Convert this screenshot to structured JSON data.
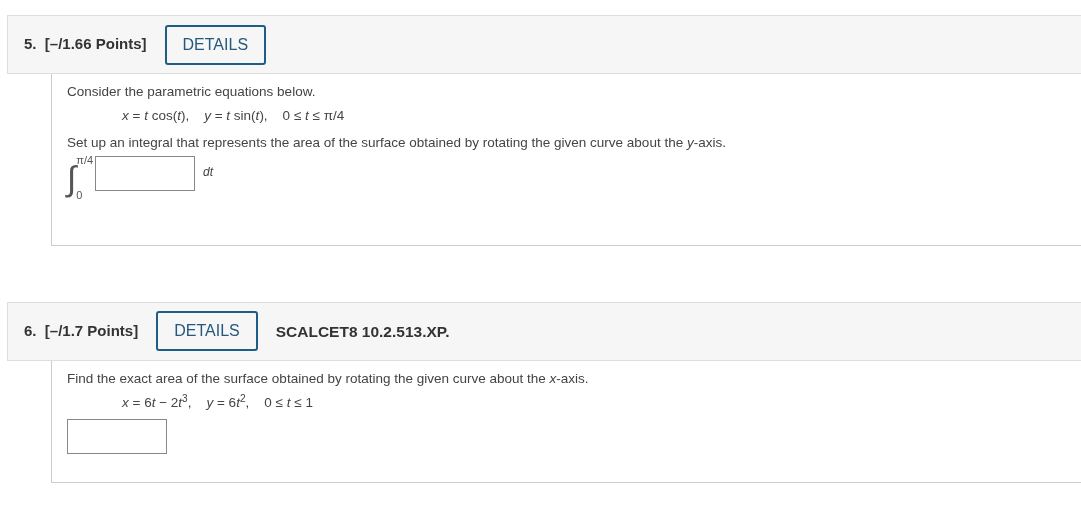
{
  "questions": [
    {
      "number": "5.",
      "points": "[–/1.66 Points]",
      "details_button": "DETAILS",
      "prompt": "Consider the parametric equations below.",
      "equation": "*x* = *t* cos(*t*),    *y* = *t* sin(*t*),    0 ≤ *t* ≤ π/4",
      "instruction": "Set up an integral that represents the area of the surface obtained by rotating the given curve about the *y*-axis.",
      "answer": {
        "kind": "integral",
        "symbol": "∫",
        "upper": "π/4",
        "lower": "0",
        "differential": "dt"
      }
    },
    {
      "number": "6.",
      "points": "[–/1.7 Points]",
      "details_button": "DETAILS",
      "source": "SCALCET8 10.2.513.XP.",
      "prompt": "Find the exact area of the surface obtained by rotating the given curve about the *x*-axis.",
      "equation_runs": [
        {
          "text": "x",
          "kind": "variable"
        },
        {
          "text": " = 6",
          "kind": "operator"
        },
        {
          "text": "t",
          "kind": "variable"
        },
        {
          "text": " − 2",
          "kind": "operator"
        },
        {
          "text": "t",
          "kind": "variable"
        },
        {
          "text": "3",
          "kind": "exponent"
        },
        {
          "text": ",    ",
          "kind": "operator"
        },
        {
          "text": "y",
          "kind": "variable"
        },
        {
          "text": " = 6",
          "kind": "operator"
        },
        {
          "text": "t",
          "kind": "variable"
        },
        {
          "text": "2",
          "kind": "exponent"
        },
        {
          "text": ",    0 ≤ ",
          "kind": "operator"
        },
        {
          "text": "t",
          "kind": "variable"
        },
        {
          "text": " ≤ 1",
          "kind": "operator"
        }
      ],
      "answer": {
        "kind": "plain"
      }
    }
  ]
}
